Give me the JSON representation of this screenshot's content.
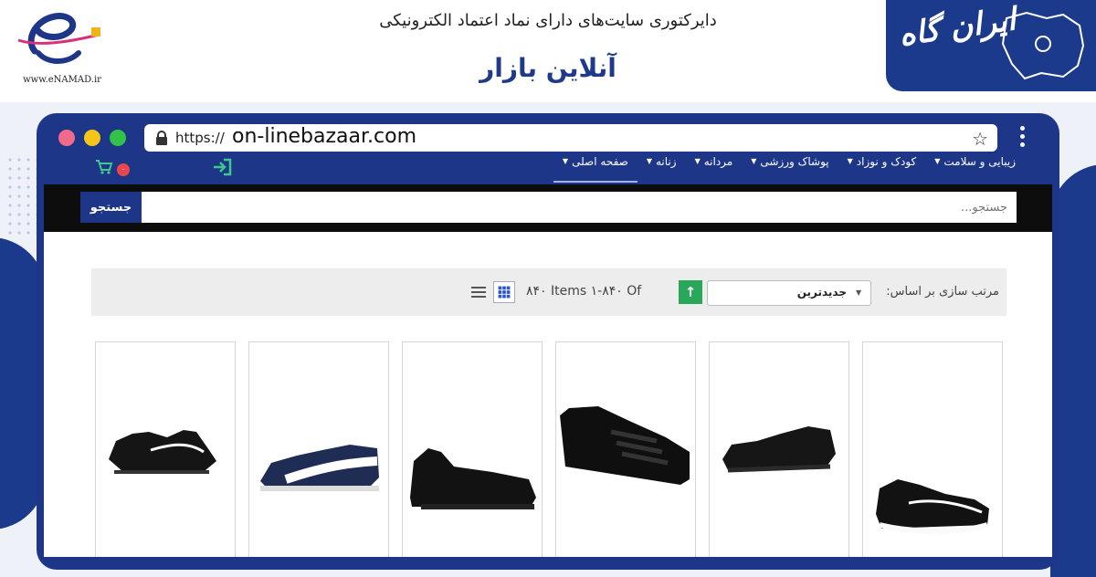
{
  "banner": {
    "enamad_url": "www.eNAMAD.ir",
    "subtitle": "دایرکتوری سایت‌های دارای نماد اعتماد الکترونیکی",
    "title": "آنلاین بازار",
    "irangah_logo": "ایران گاه"
  },
  "browser": {
    "url_prefix": "https://",
    "url_host": "on-linebazaar.com"
  },
  "site": {
    "nav": [
      {
        "label": "صفحه اصلی"
      },
      {
        "label": "زنانه"
      },
      {
        "label": "مردانه"
      },
      {
        "label": "پوشاک ورزشی"
      },
      {
        "label": "کودک و نوزاد"
      },
      {
        "label": "زیبایی و سلامت"
      }
    ],
    "cart_count": "۰",
    "search": {
      "placeholder": "جستجو...",
      "button_label": "جستجو"
    },
    "sort": {
      "label": "مرتب سازی بر اساس:",
      "selected": "جدیدترین",
      "items_text": "۸۴۰ Items ۱-۸۴۰ Of"
    }
  },
  "colors": {
    "brand_blue": "#1e3688",
    "sort_green": "#2aa85a",
    "badge_red": "#e8474f"
  }
}
